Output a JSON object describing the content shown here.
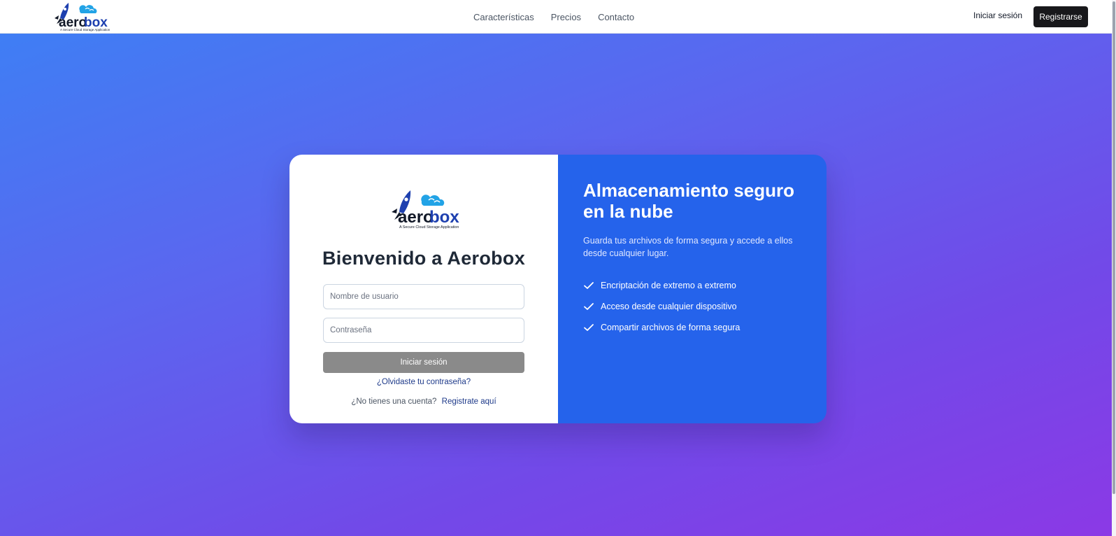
{
  "brand": {
    "name_prefix": "aero",
    "name_suffix": "box",
    "tagline": "A Secure Cloud Storage Application",
    "colors": {
      "rocket": "#1e40af",
      "cloud": "#22a3e6",
      "text_dark": "#111827",
      "text_blue": "#1e3a8a"
    }
  },
  "nav": {
    "links": [
      "Características",
      "Precios",
      "Contacto"
    ],
    "login_label": "Iniciar sesión",
    "register_label": "Registrarse"
  },
  "login_card": {
    "welcome": "Bienvenido a Aerobox",
    "username_placeholder": "Nombre de usuario",
    "password_placeholder": "Contraseña",
    "submit_label": "Iniciar sesión",
    "forgot_label": "¿Olvidaste tu contraseña?",
    "no_account_text": "¿No tienes una cuenta?",
    "signup_link": "Registrate aquí"
  },
  "info_panel": {
    "title": "Almacenamiento seguro en la nube",
    "description": "Guarda tus archivos de forma segura y accede a ellos desde cualquier lugar.",
    "features": [
      "Encriptación de extremo a extremo",
      "Acceso desde cualquier dispositivo",
      "Compartir archivos de forma segura"
    ],
    "feature_icon": "check-icon"
  },
  "colors": {
    "hero_gradient_start": "#3f7ef4",
    "hero_gradient_end": "#8b39e6",
    "panel_blue": "#2563eb",
    "button_dark": "#18181b",
    "button_gray": "#8a8a8a"
  }
}
